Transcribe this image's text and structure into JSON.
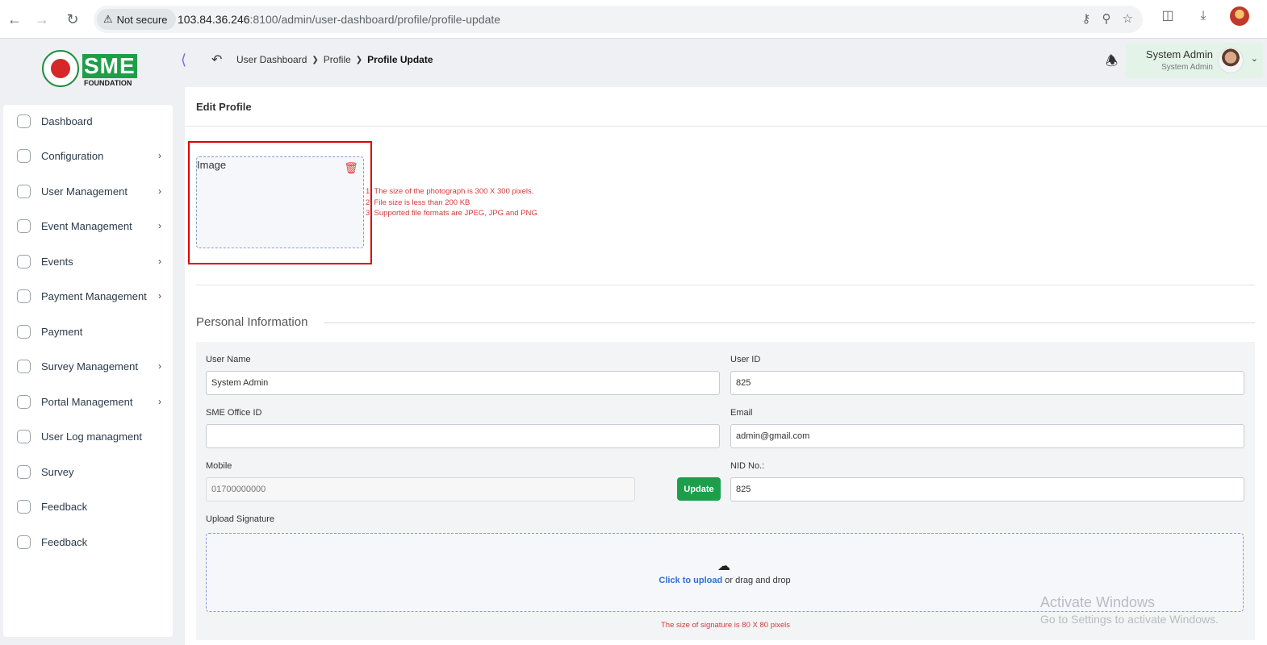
{
  "browser": {
    "security_label": "Not secure",
    "url_host": "103.84.36.246",
    "url_rest": ":8100/admin/user-dashboard/profile/profile-update"
  },
  "logo": {
    "sme": "SME",
    "foundation": "FOUNDATION"
  },
  "sidebar": {
    "items": [
      {
        "label": "Dashboard",
        "icon": "grid-icon",
        "has_submenu": false
      },
      {
        "label": "Configuration",
        "icon": "settings-icon",
        "has_submenu": true
      },
      {
        "label": "User Management",
        "icon": "shield-icon",
        "has_submenu": true
      },
      {
        "label": "Event Management",
        "icon": "lock-icon",
        "has_submenu": true
      },
      {
        "label": "Events",
        "icon": "lock-icon",
        "has_submenu": true
      },
      {
        "label": "Payment Management",
        "icon": "card-icon",
        "has_submenu": true
      },
      {
        "label": "Payment",
        "icon": "card-icon",
        "has_submenu": false
      },
      {
        "label": "Survey Management",
        "icon": "pie-icon",
        "has_submenu": true
      },
      {
        "label": "Portal Management",
        "icon": "lock-icon",
        "has_submenu": true
      },
      {
        "label": "User Log managment",
        "icon": "card-icon",
        "has_submenu": false
      },
      {
        "label": "Survey",
        "icon": "pie-icon",
        "has_submenu": false
      },
      {
        "label": "Feedback",
        "icon": "feedback-icon",
        "has_submenu": false
      },
      {
        "label": "Feedback",
        "icon": "feedback-icon",
        "has_submenu": false
      }
    ]
  },
  "breadcrumb": {
    "items": [
      "User Dashboard",
      "Profile"
    ],
    "current": "Profile Update"
  },
  "user": {
    "name": "System Admin",
    "role": "System Admin"
  },
  "card": {
    "title": "Edit Profile"
  },
  "photo": {
    "alt": "Image",
    "rules": [
      "1. The size of the photograph is 300 X 300 pixels.",
      "2. File size is less than 200 KB",
      "3. Supported file formats are JPEG, JPG and PNG"
    ]
  },
  "section": {
    "title": "Personal Information"
  },
  "form": {
    "user_name": {
      "label": "User Name",
      "value": "System Admin"
    },
    "user_id": {
      "label": "User ID",
      "value": "825"
    },
    "sme_office_id": {
      "label": "SME Office ID",
      "value": ""
    },
    "email": {
      "label": "Email",
      "value": "admin@gmail.com"
    },
    "mobile": {
      "label": "Mobile",
      "placeholder": "01700000000"
    },
    "update_label": "Update",
    "nid": {
      "label": "NID No.:",
      "value": "825"
    },
    "signature": {
      "label": "Upload Signature",
      "click_text": "Click to upload",
      "rest_text": "or drag and drop",
      "note": "The size of signature is 80 X 80 pixels"
    }
  },
  "watermark": {
    "line1": "Activate Windows",
    "line2": "Go to Settings to activate Windows."
  },
  "colors": {
    "brand_green": "#1e9e4a",
    "warning_red": "#d43a3a",
    "highlight": "#e00000",
    "link_blue": "#2f6fd6"
  }
}
